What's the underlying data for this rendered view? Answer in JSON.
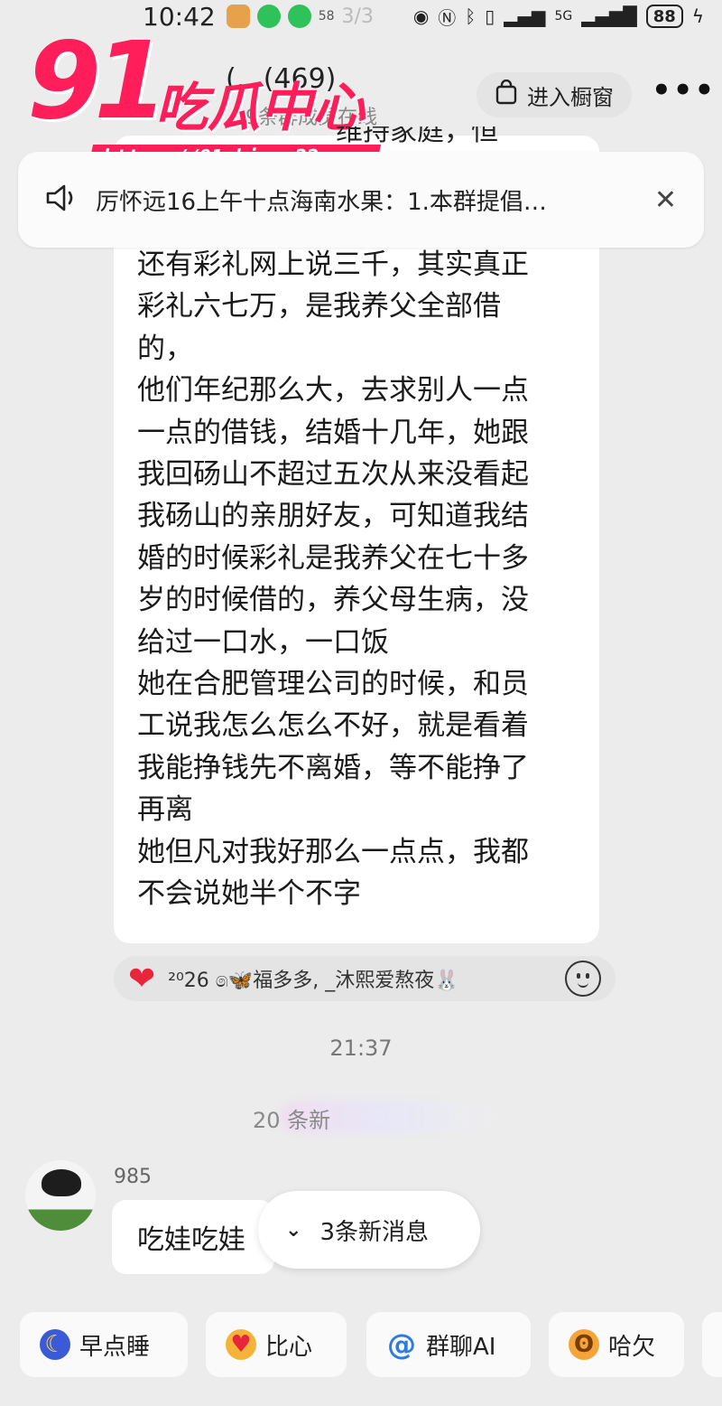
{
  "status_bar": {
    "time": "10:42",
    "small_badge": "58",
    "indicator": "3/3",
    "network": "5G",
    "battery": "88"
  },
  "watermark": {
    "number": "91",
    "text": "吃瓜中心",
    "url": "https://91chigua22.com"
  },
  "header": {
    "group_title": "(…(469)",
    "group_sub": "…9条群成员在线",
    "shop_label": "进入橱窗",
    "more_label": "•••"
  },
  "announcement": {
    "text": "厉怀远16上午十点海南水果：1.本群提倡…",
    "close": "✕"
  },
  "message": {
    "peek_text": "维持家庭，恒",
    "lines": [
      "还有彩礼网上说三千，其实真正",
      "彩礼六七万，是我养父全部借",
      "的，",
      "他们年纪那么大，去求别人一点",
      "一点的借钱，结婚十几年，她跟",
      "我回砀山不超过五次从来没看起",
      "我砀山的亲朋好友，可知道我结",
      "婚的时候彩礼是我养父在七十多",
      "岁的时候借的，养父母生病，没",
      "给过一口水，一口饭",
      "她在合肥管理公司的时候，和员",
      "工说我怎么怎么不好，就是看着",
      "我能挣钱先不离婚，等不能挣了",
      "再离",
      "她但凡对我好那么一点点，我都",
      "不会说她半个不字"
    ]
  },
  "reactions": {
    "heart": "❤",
    "users": "²⁰26 ෧🦋福多多, _沐熙爱熬夜🐰"
  },
  "timestamp": "21:37",
  "new_divider": "20 条新",
  "second_message": {
    "sender": "985",
    "text": "吃娃吃娃"
  },
  "new_msg_pill": {
    "chevron": "⌄",
    "label": "3条新消息"
  },
  "quick_actions": [
    {
      "label": "早点睡",
      "icon": "moon-icon",
      "color": "#3b5bd6",
      "glyph": "☾"
    },
    {
      "label": "比心",
      "icon": "heart-hands-icon",
      "color": "#f4b43a",
      "glyph": "♥"
    },
    {
      "label": "群聊AI",
      "icon": "at-icon",
      "color": "#2b7be4",
      "glyph": "@"
    },
    {
      "label": "哈欠",
      "icon": "yawn-icon",
      "color": "#f4a53a",
      "glyph": "ʘ"
    }
  ]
}
